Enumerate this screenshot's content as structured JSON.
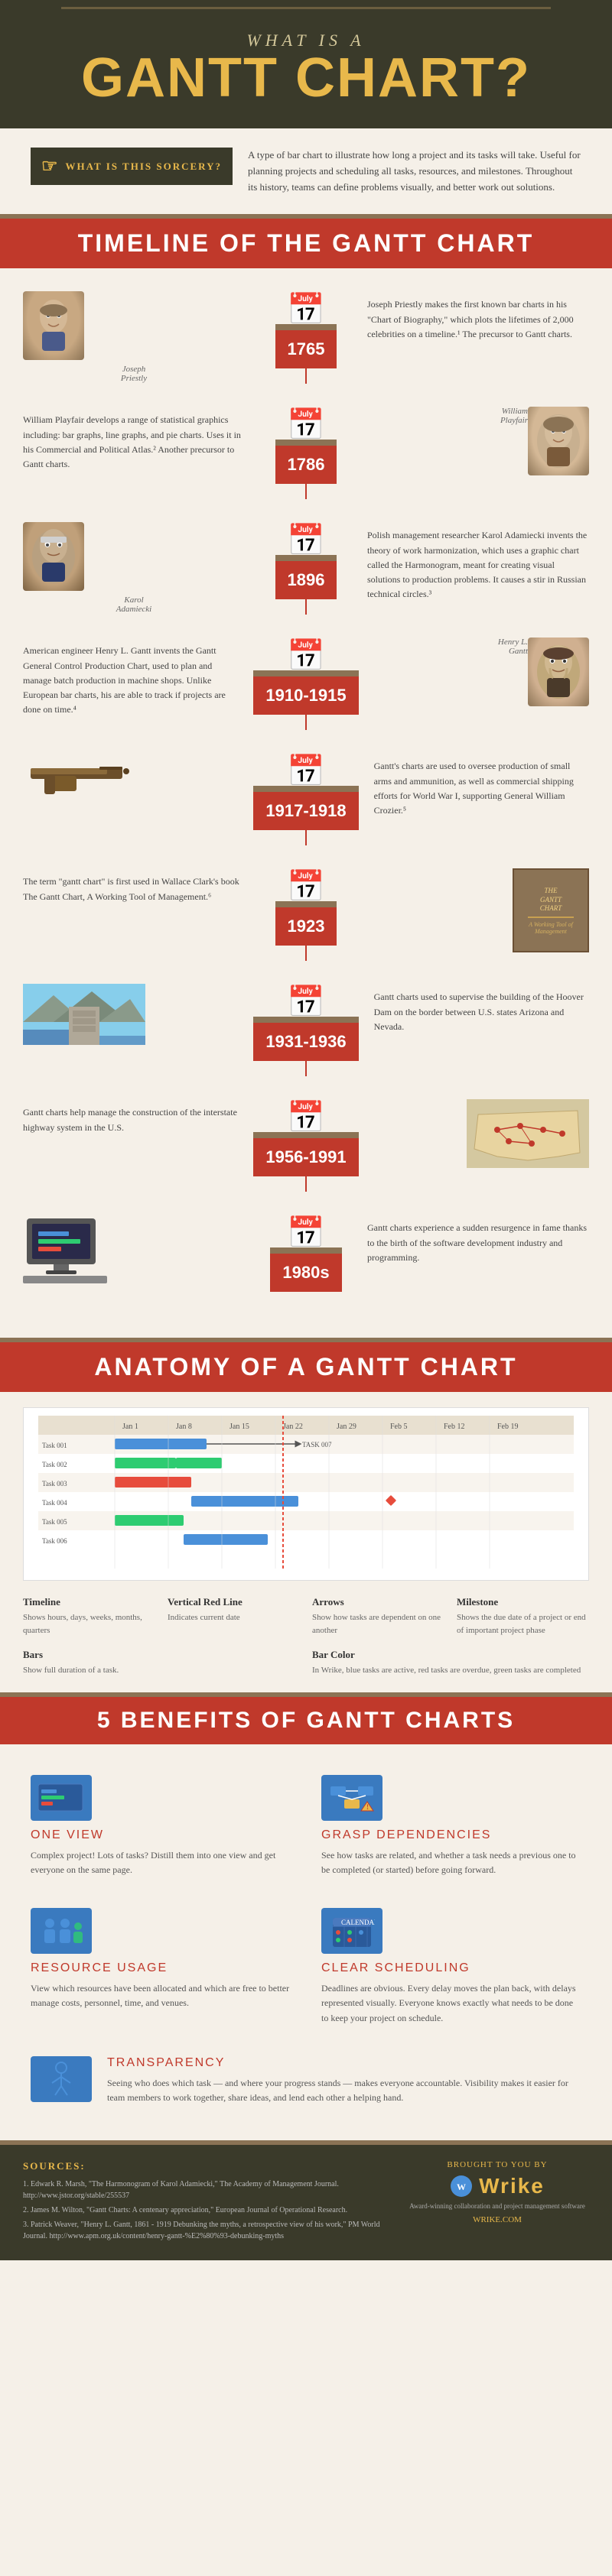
{
  "header": {
    "what_is_a": "What is a",
    "title": "Gantt Chart?",
    "question_mark": "?",
    "sorcery_label": "What is this sorcery?",
    "intro_text": "A type of bar chart to illustrate how long a project and its tasks will take. Useful for planning projects and scheduling all tasks, resources, and milestones. Throughout its history, teams can define problems visually, and better work out solutions."
  },
  "timeline_section": {
    "header": "Timeline of the Gantt Chart",
    "entries": [
      {
        "year": "1765",
        "side": "left",
        "person": "Joseph Priestly",
        "desc": "Joseph Priestly makes the first known bar charts in his \"Chart of Biography,\" which plots the lifetimes of 2,000 celebrities on a timeline.¹ The precursor to Gantt charts.",
        "note": "1"
      },
      {
        "year": "1786",
        "side": "right",
        "person": "William Playfair",
        "desc": "William Playfair develops a range of statistical graphics including: bar graphs, line graphs, and pie charts. Uses it in his Commercial and Political Atlas.² Another precursor to Gantt charts.",
        "note": "2"
      },
      {
        "year": "1896",
        "side": "left",
        "person": "Karol Adamiecki",
        "desc": "Polish management researcher Karol Adamiecki invents the theory of work harmonization, which uses a graphic chart called the Harmonogram, meant for creating visual solutions to production problems. It causes a stir in Russian technical circles.³",
        "note": "3"
      },
      {
        "year": "1910-1915",
        "side": "right",
        "person": "Henry L. Gantt",
        "desc": "American engineer Henry L. Gantt invents the Gantt General Control Production Chart, used to plan and manage batch production in machine shops. Unlike European bar charts, his are able to track if projects are done on time.⁴",
        "note": "4"
      },
      {
        "year": "1917-1918",
        "side": "left",
        "image_type": "gun",
        "desc": "Gantt's charts are used to oversee production of small arms and ammunition, as well as commercial shipping efforts for World War I, supporting General William Crozier.⁵",
        "note": "5"
      },
      {
        "year": "1923",
        "side": "right",
        "image_type": "book",
        "desc": "The term \"gantt chart\" is first used in Wallace Clark's book The Gantt Chart, A Working Tool of Management.⁶",
        "note": "6"
      },
      {
        "year": "1931-1936",
        "side": "left",
        "image_type": "dam",
        "desc": "Gantt charts used to supervise the building of the Hoover Dam on the border between U.S. states Arizona and Nevada.",
        "note": ""
      },
      {
        "year": "1956-1991",
        "side": "right",
        "image_type": "map",
        "desc": "Gantt charts help manage the construction of the interstate highway system in the U.S.",
        "note": ""
      },
      {
        "year": "1980s",
        "side": "left",
        "image_type": "computer",
        "desc": "Gantt charts experience a sudden resurgence in fame thanks to the birth of the software development industry and programming.",
        "note": ""
      }
    ]
  },
  "anatomy_section": {
    "header": "Anatomy of a Gantt Chart",
    "labels": [
      {
        "title": "Timeline",
        "desc": "Shows hours, days, weeks, months, quarters"
      },
      {
        "title": "Vertical Red Line",
        "desc": "Indicates current date"
      },
      {
        "title": "Arrows",
        "desc": "Show how tasks are dependent on one another"
      },
      {
        "title": "Milestone",
        "desc": "Shows the due date of a project or end of important project phase"
      },
      {
        "title": "Bars",
        "desc": "Show full duration of a task."
      },
      {
        "title": "Bar Color",
        "desc": "In Wrike, blue tasks are active, red tasks are overdue, green tasks are completed"
      }
    ]
  },
  "benefits_section": {
    "header": "5 Benefits of Gantt Charts",
    "items": [
      {
        "title": "One View",
        "desc": "Complex project! Lots of tasks? Distill them into one view and get everyone on the same page.",
        "icon": "📊"
      },
      {
        "title": "Grasp Dependencies",
        "desc": "See how tasks are related, and whether a task needs a previous one to be completed (or started) before going forward.",
        "icon": "🔗"
      },
      {
        "title": "Resource Usage",
        "desc": "View which resources have been allocated and which are free to better manage costs, personnel, time, and venues.",
        "icon": "👥"
      },
      {
        "title": "Clear Scheduling",
        "desc": "Deadlines are obvious. Every delay moves the plan back, with delays represented visually. Everyone knows exactly what needs to be done to keep your project on schedule.",
        "icon": "📅"
      },
      {
        "title": "Transparency",
        "desc": "Seeing who does which task — and where your progress stands — makes everyone accountable. Visibility makes it easier for team members to work together, share ideas, and lend each other a helping hand.",
        "icon": "👁"
      }
    ]
  },
  "footer": {
    "sources_title": "Sources:",
    "sources": [
      "1. Edwark R. Marsh, \"The Harmonogram of Karol Adamiecki,\" The Academy of Management Journal. http://www.jstor.org/stable/255537",
      "2. James M. Wilton, \"Gantt Charts: A centenary appreciation,\" European Journal of Operational Research.",
      "3. Patrick Weaver, \"Henry L. Gantt, 1861 - 1919 Debunking the myths, a retrospective view of his work,\" PM World Journal. http://www.apm.org.uk/content/henry-gantt-%E2%80%93-debunking-myths"
    ],
    "brought_by": "Brought to you by",
    "brand_name": "Wrike",
    "brand_tagline": "Award-winning collaboration and project management software",
    "brand_url": "WRIKE.COM"
  }
}
